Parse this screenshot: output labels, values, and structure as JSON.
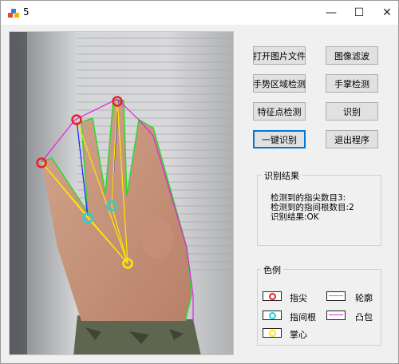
{
  "window": {
    "title": "5"
  },
  "buttons": {
    "open_image": "打开图片文件",
    "image_filter": "图像滤波",
    "gesture_region": "手势区域检测",
    "palm_detect": "手掌检测",
    "feature_points": "特征点检测",
    "recognize": "识别",
    "one_click": "一键识别",
    "exit": "退出程序"
  },
  "result": {
    "title": "识别结果",
    "fingertips": "检测到的指尖数目3:",
    "finger_roots": "检测到的指间根数目:2",
    "status": "识别结果:OK"
  },
  "legend": {
    "title": "色例",
    "items": [
      {
        "label": "指尖",
        "color": "#e8202a",
        "kind": "circle"
      },
      {
        "label": "指间根",
        "color": "#17d7e0",
        "kind": "circle"
      },
      {
        "label": "掌心",
        "color": "#ffe800",
        "kind": "circle"
      },
      {
        "label": "轮廓",
        "color": "#2fd82f",
        "kind": "line"
      },
      {
        "label": "凸包",
        "color": "#e020e0",
        "kind": "line"
      }
    ]
  },
  "colors": {
    "fingertip": "#e8202a",
    "finger_root": "#17d7e0",
    "palm_center": "#ffe800",
    "contour": "#2fd82f",
    "hull": "#e020e0",
    "finger_axis": "#1a1aff"
  },
  "icons": {
    "app": "app-icon",
    "minimize": "minimize-icon",
    "maximize": "maximize-icon",
    "close": "close-icon"
  }
}
